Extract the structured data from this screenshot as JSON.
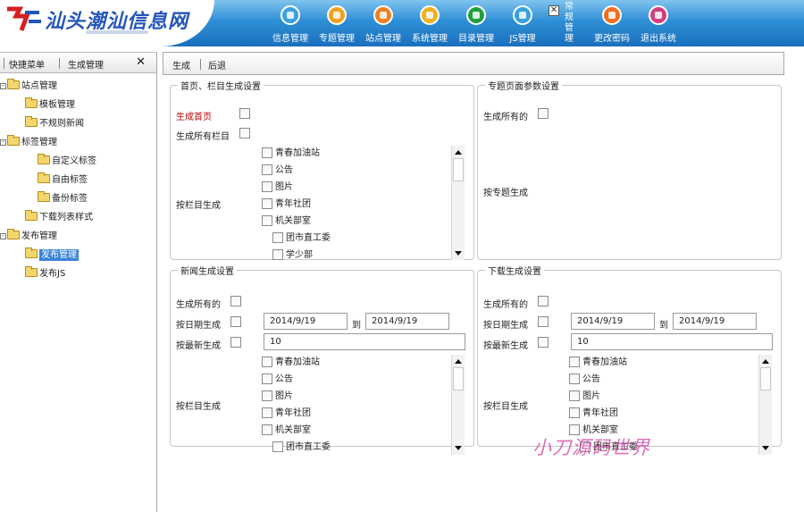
{
  "app": {
    "logo_text": "汕头潮汕信息网",
    "nav": [
      {
        "label": "信息管理",
        "icon": "info-manage-icon",
        "color": "#3aa0e0"
      },
      {
        "label": "专题管理",
        "icon": "topic-manage-icon",
        "color": "#f0a020"
      },
      {
        "label": "站点管理",
        "icon": "site-manage-icon",
        "color": "#f08020"
      },
      {
        "label": "系统管理",
        "icon": "system-manage-icon",
        "color": "#f0b020"
      },
      {
        "label": "目录管理",
        "icon": "directory-manage-icon",
        "color": "#20a040"
      },
      {
        "label": "JS管理",
        "icon": "js-manage-icon",
        "color": "#3aa0e0"
      },
      {
        "label": "更改密码",
        "icon": "change-password-icon",
        "color": "#f07020"
      },
      {
        "label": "退出系统",
        "icon": "logout-icon",
        "color": "#d04080"
      }
    ],
    "vertical_text": "常规管理"
  },
  "sidebar": {
    "tab_shortcut": "快捷菜单",
    "tab_generate": "生成管理",
    "close_label": "✕",
    "tree": [
      {
        "label": "站点管理",
        "level": 0,
        "expand": "-"
      },
      {
        "label": "模板管理",
        "level": 1
      },
      {
        "label": "不规则新闻",
        "level": 1
      },
      {
        "label": "标签管理",
        "level": 0,
        "expand": "-",
        "indent": 1
      },
      {
        "label": "自定义标签",
        "level": 2
      },
      {
        "label": "自由标签",
        "level": 2
      },
      {
        "label": "备份标签",
        "level": 2
      },
      {
        "label": "下载列表样式",
        "level": 1
      },
      {
        "label": "发布管理",
        "level": 0,
        "expand": "-"
      },
      {
        "label": "发布管理",
        "level": 1,
        "selected": true
      },
      {
        "label": "发布JS",
        "level": 1
      }
    ]
  },
  "toolbar": {
    "generate": "生成",
    "back": "后退"
  },
  "home_section": {
    "legend": "首页、栏目生成设置",
    "gen_home": "生成首页",
    "gen_all_columns": "生成所有栏目",
    "by_column": "按栏目生成",
    "items": [
      "青春加油站",
      "公告",
      "图片",
      "青年社团",
      "机关部室",
      "团市直工委",
      "学少部"
    ]
  },
  "topic_section": {
    "legend": "专题页面参数设置",
    "gen_all": "生成所有的",
    "by_topic": "按专题生成"
  },
  "news_section": {
    "legend": "新闻生成设置",
    "gen_all": "生成所有的",
    "by_date": "按日期生成",
    "date_from": "2014/9/19",
    "to": "到",
    "date_to": "2014/9/19",
    "by_latest": "按最新生成",
    "latest_count": "10",
    "by_column": "按栏目生成",
    "items": [
      "青春加油站",
      "公告",
      "图片",
      "青年社团",
      "机关部室",
      "团市直工委"
    ]
  },
  "download_section": {
    "legend": "下载生成设置",
    "gen_all": "生成所有的",
    "by_date": "按日期生成",
    "date_from": "2014/9/19",
    "to": "到",
    "date_to": "2014/9/19",
    "by_latest": "按最新生成",
    "latest_count": "10",
    "by_column": "按栏目生成",
    "items": [
      "青春加油站",
      "公告",
      "图片",
      "青年社团",
      "机关部室",
      "团市直工委"
    ]
  },
  "watermark": "小刀源码世界"
}
